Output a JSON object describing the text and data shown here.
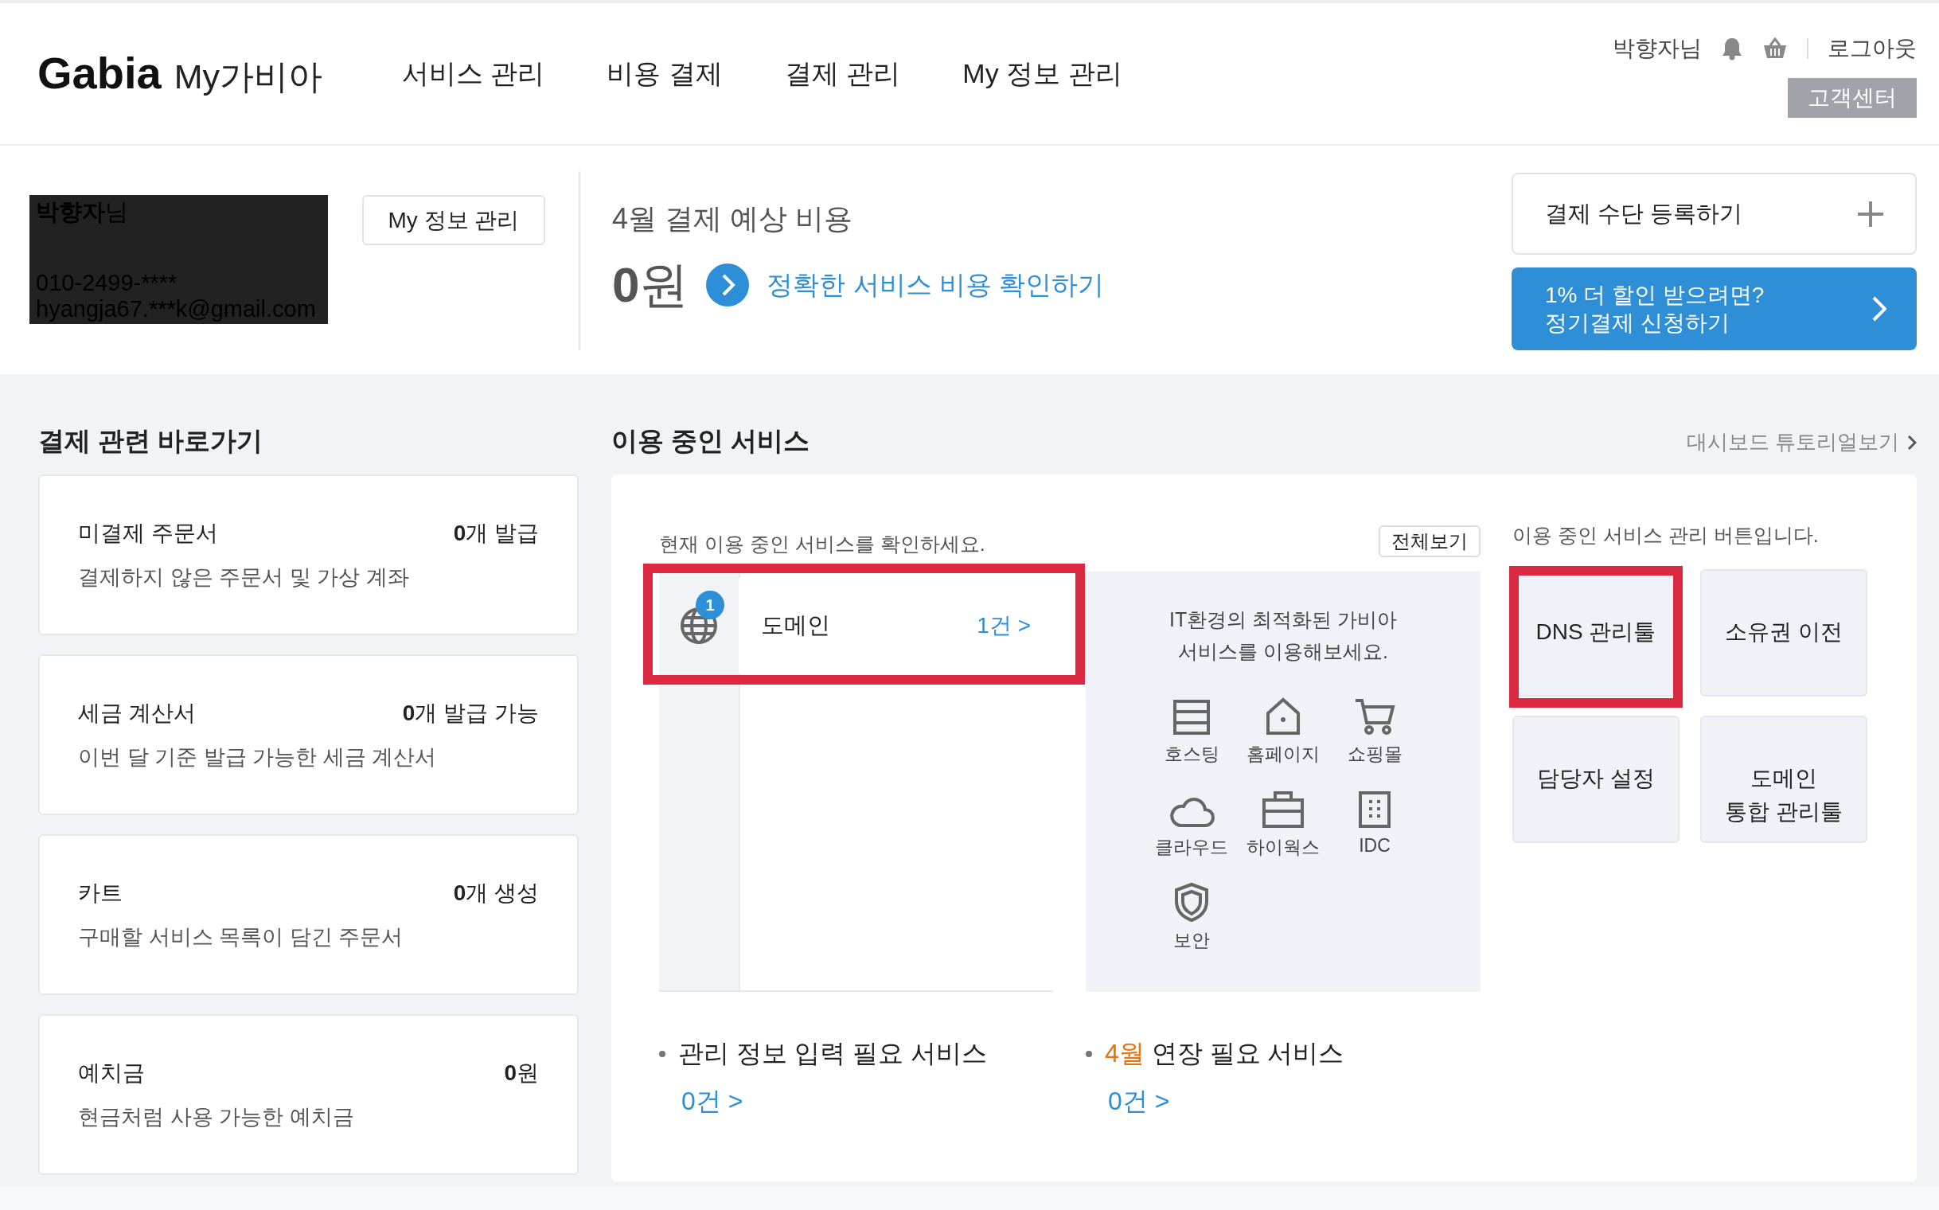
{
  "header": {
    "logo": "Gabia",
    "logo_sub": "My가비아",
    "nav": [
      {
        "label": "서비스 관리"
      },
      {
        "label": "비용 결제"
      },
      {
        "label": "결제 관리"
      },
      {
        "label": "My 정보 관리"
      }
    ],
    "user": "박향자님",
    "logout": "로그아웃",
    "support_button": "고객센터"
  },
  "profile": {
    "name": "**박향자**님",
    "phone": "010-2499-****",
    "email": "hyangja67.***k@gmail.com",
    "button": "My 정보 관리"
  },
  "cost": {
    "title": "4월 결제 예상 비용",
    "amount": "**0**원",
    "link": "정확한 서비스 비용 확인하기"
  },
  "payment": {
    "register": "결제 수단 등록하기",
    "promo_lines": [
      "1% 더 할인 받으려면?",
      "정기결제 신청하기"
    ]
  },
  "shortcuts": {
    "title": "결제 관련 바로가기",
    "items": [
      {
        "name": "미결제 주문서",
        "count": "**0**개 발급",
        "desc": "결제하지 않은 주문서 및 가상 계좌"
      },
      {
        "name": "세금 계산서",
        "count": "**0**개 발급 가능",
        "desc": "이번 달 기준 발급 가능한 세금 계산서"
      },
      {
        "name": "카트",
        "count": "**0**개 생성",
        "desc": "구매할 서비스 목록이 담긴 주문서"
      },
      {
        "name": "예치금",
        "count": "**0**원",
        "desc": "현금처럼 사용 가능한 예치금"
      }
    ]
  },
  "services": {
    "title": "이용 중인 서비스",
    "tutorial_link": "대시보드 튜토리얼보기",
    "hint": "현재 이용 중인 서비스를 확인하세요.",
    "view_all": "전체보기",
    "items": [
      {
        "name": "도메인",
        "badge": "1",
        "count": "1건 >",
        "highlighted": true
      }
    ],
    "promo_text": [
      "IT환경의 최적화된 가비아",
      "서비스를 이용해보세요."
    ],
    "promo_services": [
      {
        "label": "호스팅",
        "kind": "server"
      },
      {
        "label": "홈페이지",
        "kind": "house"
      },
      {
        "label": "쇼핑몰",
        "kind": "cart"
      },
      {
        "label": "클라우드",
        "kind": "cloud"
      },
      {
        "label": "하이웍스",
        "kind": "briefcase"
      },
      {
        "label": "IDC",
        "kind": "building"
      },
      {
        "label": "보안",
        "kind": "shield"
      }
    ],
    "tools_hint": "이용 중인 서비스 관리 버튼입니다.",
    "tools": [
      {
        "lines": [
          "DNS 관리툴"
        ],
        "highlighted": true
      },
      {
        "lines": [
          "소유권 이전"
        ],
        "highlighted": false
      },
      {
        "lines": [
          "담당자 설정"
        ],
        "highlighted": false
      },
      {
        "lines": [
          "도메인",
          "통합 관리툴"
        ],
        "highlighted": false
      }
    ],
    "notices": [
      {
        "title": "관리 정보 입력 필요 서비스",
        "count": "0건 >"
      },
      {
        "month": "4월",
        "title": "연장 필요 서비스",
        "count": "0건 >"
      }
    ]
  }
}
